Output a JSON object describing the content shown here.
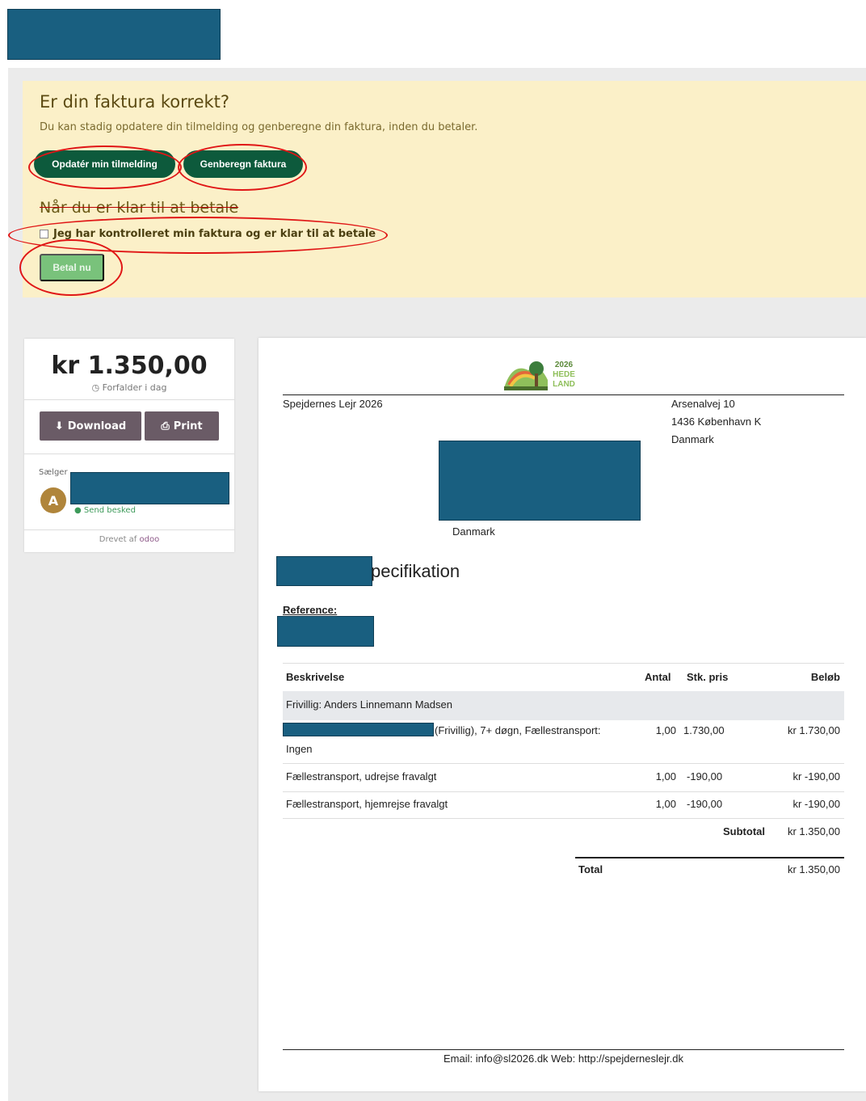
{
  "banner": {
    "title": "Er din faktura korrekt?",
    "subtitle": "Du kan stadig opdatere din tilmelding og genberegne din faktura, inden du betaler.",
    "update_button": "Opdatér min tilmelding",
    "recalc_button": "Genberegn faktura",
    "ready_heading": "Når du er klar til at betale",
    "checkbox_label": "Jeg har kontrolleret min faktura og er klar til at betale",
    "pay_button": "Betal nu"
  },
  "summary": {
    "amount": "kr 1.350,00",
    "due": "Forfalder i dag",
    "download_label": "Download",
    "print_label": "Print",
    "seller_label": "Sælger",
    "avatar_letter": "A",
    "send_message": "Send besked",
    "powered_by": "Drevet af",
    "powered_brand": "odoo"
  },
  "invoice": {
    "company": "Spejdernes Lejr 2026",
    "address": [
      "Arsenalvej 10",
      "1436 København K",
      "Danmark"
    ],
    "customer_country": "Danmark",
    "title_suffix": "pecifikation",
    "reference_label": "Reference:",
    "columns": [
      "Beskrivelse",
      "Antal",
      "Stk. pris",
      "Beløb"
    ],
    "section": "Frivillig: Anders Linnemann Madsen",
    "lines": [
      {
        "desc": "(Frivillig), 7+ døgn, Fællestransport:",
        "desc2": "Ingen",
        "qty": "1,00",
        "price": "1.730,00",
        "amount": "kr 1.730,00"
      },
      {
        "desc": "Fællestransport, udrejse fravalgt",
        "qty": "1,00",
        "price": "-190,00",
        "amount": "kr -190,00"
      },
      {
        "desc": "Fællestransport, hjemrejse fravalgt",
        "qty": "1,00",
        "price": "-190,00",
        "amount": "kr -190,00"
      }
    ],
    "subtotal_label": "Subtotal",
    "subtotal": "kr 1.350,00",
    "total_label": "Total",
    "total": "kr 1.350,00",
    "footer": "Email: info@sl2026.dk   Web: http://spejderneslejr.dk"
  },
  "logo": {
    "year": "2026",
    "line1": "HEDE",
    "line2": "LAND"
  },
  "colors": {
    "redaction": "#195f80",
    "banner": "#fbf0c8",
    "dark_button": "#0d5a3c",
    "pay_button": "#79c27b",
    "annotation": "#e01616"
  }
}
